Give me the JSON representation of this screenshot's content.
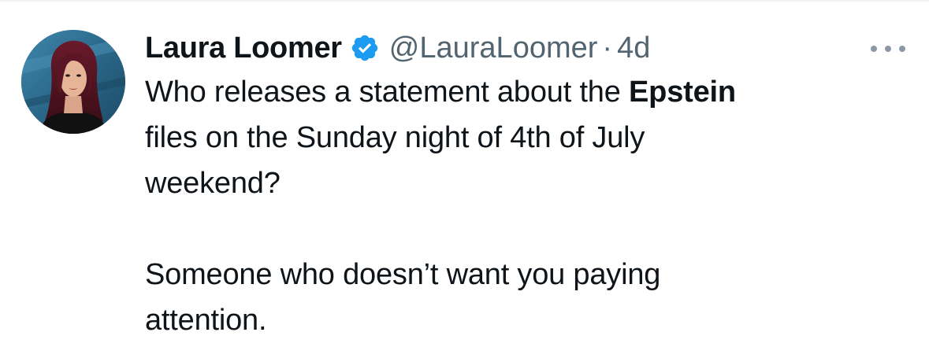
{
  "author": {
    "display_name": "Laura Loomer",
    "verified_icon": "verified-badge-icon",
    "handle": "@LauraLoomer",
    "separator": "·",
    "time_ago": "4d"
  },
  "tweet": {
    "line1_prefix": "Who releases a statement about the ",
    "line1_bold": "Epstein",
    "line2": "files on the Sunday night of 4th of July",
    "line3": "weekend?",
    "line4": "Someone who doesn’t want you paying",
    "line5": "attention."
  },
  "menu": {
    "more_icon": "more-options-icon"
  },
  "colors": {
    "verified_blue": "#1d9bf0",
    "text_primary": "#0f1419",
    "text_secondary": "#536471"
  }
}
